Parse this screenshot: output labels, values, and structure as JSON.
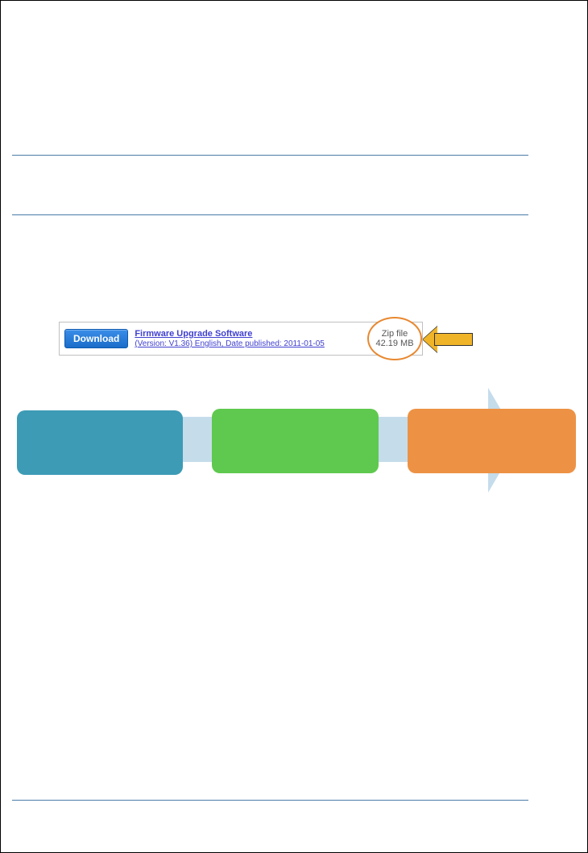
{
  "download": {
    "buttonLabel": "Download",
    "title": "Firmware Upgrade Software",
    "subtitle": "(Version: V1.36) English, Date published: 2011-01-05",
    "fileType": "Zip file",
    "fileSize": "42.19 MB"
  }
}
